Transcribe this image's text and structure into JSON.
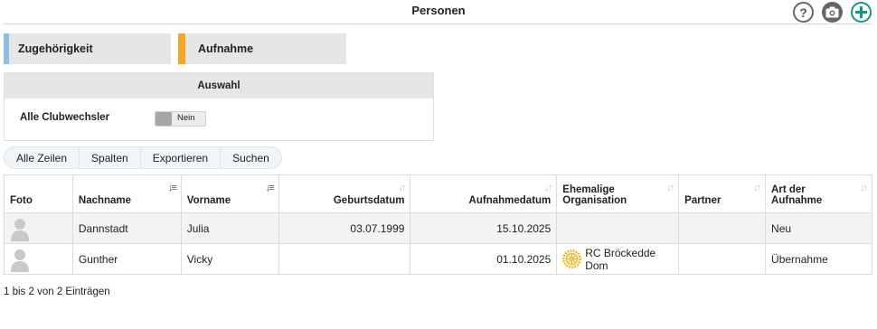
{
  "header": {
    "title": "Personen",
    "help_icon": "help-icon",
    "camera_icon": "camera-icon",
    "add_icon": "add-icon",
    "accent_color": "#16977f"
  },
  "tabs": [
    {
      "label": "Zugehörigkeit",
      "accent": "#8fbfe0"
    },
    {
      "label": "Aufnahme",
      "accent": "#f5a623"
    }
  ],
  "auswahl": {
    "title": "Auswahl",
    "filter_label": "Alle Clubwechsler",
    "toggle_value": "Nein"
  },
  "toolbar": {
    "all_rows": "Alle Zeilen",
    "columns": "Spalten",
    "export": "Exportieren",
    "search": "Suchen"
  },
  "table": {
    "columns": {
      "foto": "Foto",
      "nachname": "Nachname",
      "vorname": "Vorname",
      "geburtsdatum": "Geburtsdatum",
      "aufnahmedatum": "Aufnahmedatum",
      "ehemalige_organisation_1": "Ehemalige",
      "ehemalige_organisation_2": "Organisation",
      "partner": "Partner",
      "art_der_aufnahme_1": "Art der",
      "art_der_aufnahme_2": "Aufnahme"
    },
    "rows": [
      {
        "nachname": "Dannstadt",
        "vorname": "Julia",
        "geburtsdatum": "03.07.1999",
        "aufnahmedatum": "15.10.2025",
        "organisation": "",
        "partner": "",
        "art": "Neu"
      },
      {
        "nachname": "Gunther",
        "vorname": "Vicky",
        "geburtsdatum": "",
        "aufnahmedatum": "01.10.2025",
        "organisation": "RC Bröckedde Dom",
        "partner": "",
        "art": "Übernahme"
      }
    ]
  },
  "footer": {
    "info": "1 bis 2 von 2 Einträgen"
  }
}
